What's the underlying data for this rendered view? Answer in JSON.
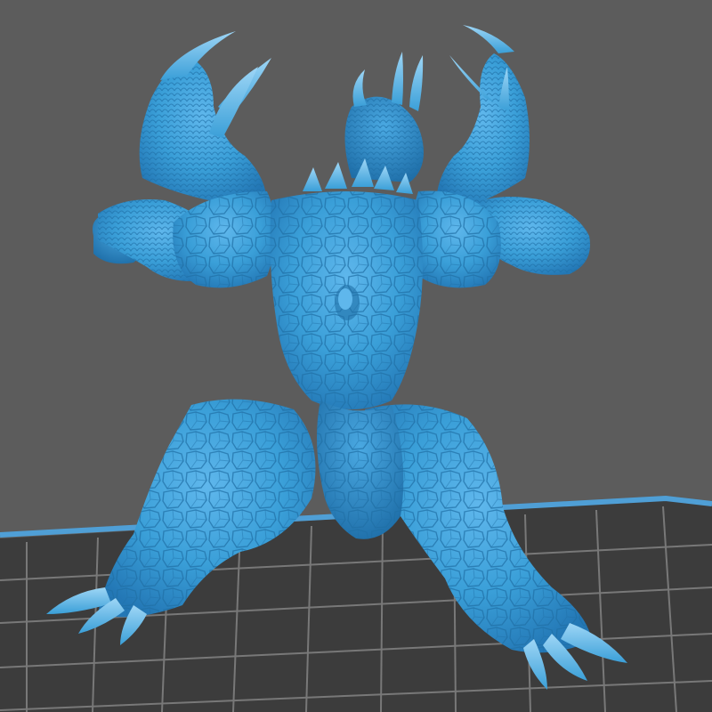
{
  "viewport": {
    "background": "#5c5c5c"
  },
  "build_plate": {
    "fill": "#3a3a3a",
    "grid_color": "#7a7a7a",
    "border_color": "#4f9fd6"
  },
  "model": {
    "color": "#3a9fd8",
    "shadow_color": "#1f6fa6",
    "highlight_color": "#7cc6f2"
  }
}
